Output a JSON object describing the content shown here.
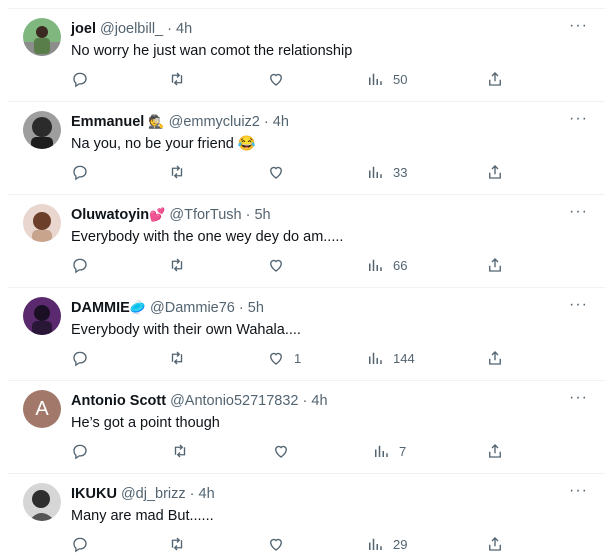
{
  "replies": [
    {
      "name": "joel",
      "badge": "",
      "handle": "@joelbill_",
      "time": "4h",
      "text": "No worry he just wan comot the relationship",
      "replies": "",
      "retweets": "",
      "likes": "",
      "views": "50",
      "avatar_color": "#7fb77e"
    },
    {
      "name": "Emmanuel",
      "badge": "🕵",
      "handle": "@emmycluiz2",
      "time": "4h",
      "text": "Na you, no be your friend 😂",
      "replies": "",
      "retweets": "",
      "likes": "",
      "views": "33",
      "avatar_color": "#3a3a3a"
    },
    {
      "name": "Oluwatoyin",
      "badge": "💕",
      "handle": "@TforTush",
      "time": "5h",
      "text": "Everybody with the one wey dey do am.....",
      "replies": "",
      "retweets": "",
      "likes": "",
      "views": "66",
      "avatar_color": "#c9a48c"
    },
    {
      "name": "DAMMIE",
      "badge": "🥏",
      "handle": "@Dammie76",
      "time": "5h",
      "text": "Everybody with their own Wahala....",
      "replies": "",
      "retweets": "",
      "likes": "1",
      "views": "144",
      "avatar_color": "#5b2a6e"
    },
    {
      "name": "Antonio Scott",
      "badge": "",
      "handle": "@Antonio52717832",
      "time": "4h",
      "text": "He’s got a point though",
      "replies": "",
      "retweets": "",
      "likes": "",
      "views": "7",
      "avatar_letter": "A",
      "avatar_color": "#a1786a"
    },
    {
      "name": "IKUKU",
      "badge": "",
      "handle": "@dj_brizz",
      "time": "4h",
      "text": "Many are mad But......",
      "replies": "",
      "retweets": "",
      "likes": "",
      "views": "29",
      "avatar_color": "#d6d6d6"
    }
  ],
  "dot": "·",
  "more": "···",
  "colors": {
    "text": "#0f1419",
    "muted": "#536471",
    "border": "#eff3f4"
  }
}
